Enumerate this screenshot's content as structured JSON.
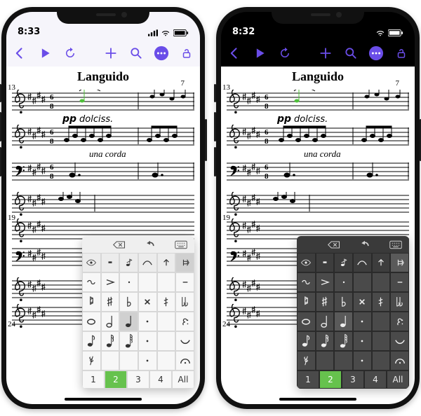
{
  "phones": [
    {
      "theme": "light",
      "time": "8:33"
    },
    {
      "theme": "dark",
      "time": "8:32"
    }
  ],
  "score": {
    "title": "Languido",
    "bar_numbers": [
      "13",
      "19",
      "24"
    ],
    "dynamics": {
      "pp": "pp",
      "dolciss": "dolciss."
    },
    "pedal": "una corda",
    "fingering": "7",
    "time_sig": {
      "top": "6",
      "bot": "8"
    }
  },
  "palette": {
    "voices": [
      "1",
      "2",
      "3",
      "4",
      "All"
    ],
    "active_voice": "2"
  }
}
